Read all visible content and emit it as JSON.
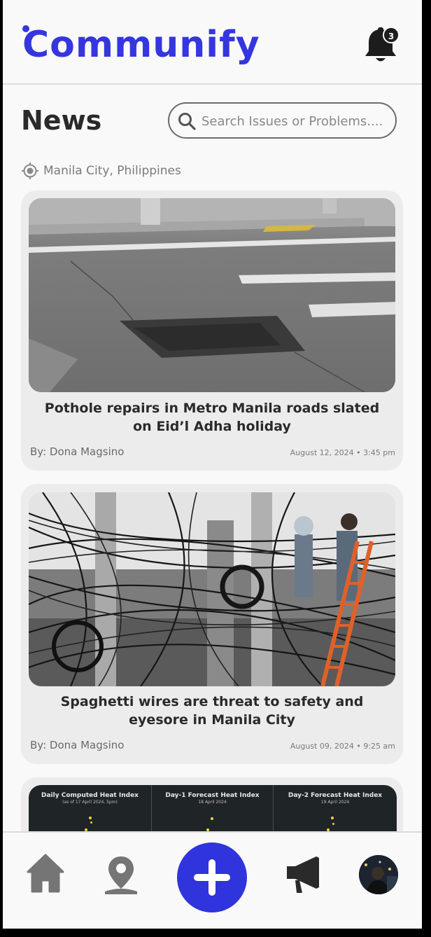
{
  "app": {
    "logo_text": "Communify",
    "notification_count": "3"
  },
  "page": {
    "title": "News"
  },
  "search": {
    "placeholder": "Search Issues or Problems...."
  },
  "location": {
    "label": "Manila City, Philippines"
  },
  "news": [
    {
      "title": "Pothole repairs in Metro Manila roads slated on Eid’l Adha holiday",
      "author": "By: Dona Magsino",
      "date": "August 12, 2024 • 3:45 pm",
      "image": "pothole-photo"
    },
    {
      "title": "Spaghetti wires are threat to safety and eyesore in Manila City",
      "author": "By: Dona Magsino",
      "date": "August 09, 2024 • 9:25 am",
      "image": "tangled-wires-photo"
    },
    {
      "image": "heat-index-map",
      "panels": [
        {
          "title": "Daily Computed Heat Index",
          "subtitle": "(as of 17 April 2024, 5pm)"
        },
        {
          "title": "Day-1 Forecast Heat Index",
          "subtitle": "18 April 2024"
        },
        {
          "title": "Day-2 Forecast Heat Index",
          "subtitle": "19 April 2024"
        }
      ]
    }
  ],
  "bottom_nav": {
    "items": [
      "home-icon",
      "map-pin-icon",
      "plus-icon",
      "megaphone-icon",
      "profile-avatar"
    ]
  },
  "colors": {
    "brand": "#3536de",
    "add_button": "#2f34dc",
    "text_dark": "#2a2a2a"
  }
}
